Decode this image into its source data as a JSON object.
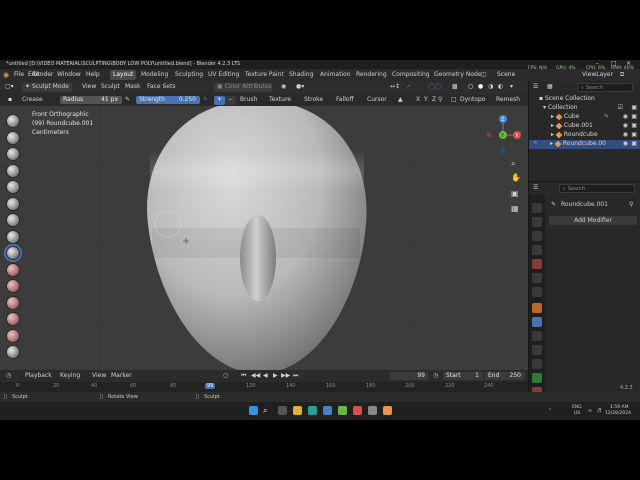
{
  "window": {
    "title": "*untitled [D:\\VIDEO MATERIAL\\SCULPTING\\BODY LOW POLY\\untitled.blend] - Blender 4.2.3 LTS"
  },
  "menubar": {
    "items": [
      "File",
      "Edit",
      "Render",
      "Window",
      "Help"
    ],
    "workspaces": [
      "Layout",
      "Modeling",
      "Sculpting",
      "UV Editing",
      "Texture Paint",
      "Shading",
      "Animation",
      "Rendering",
      "Compositing",
      "Geometry Node"
    ],
    "active_workspace": "Layout",
    "scene_label": "Scene",
    "view_layer_label": "ViewLayer"
  },
  "viewport_header": {
    "mode": "Sculpt Mode",
    "menus": [
      "View",
      "Sculpt",
      "Mask",
      "Face Sets"
    ],
    "color_attributes": "Color Attributes"
  },
  "tool_header": {
    "tool": "Crease",
    "radius_label": "Radius",
    "radius_value": "41 px",
    "strength_label": "Strength",
    "strength_value": "0.250",
    "menus": [
      "Brush",
      "Texture",
      "Stroke",
      "Falloff",
      "Cursor"
    ],
    "axes": [
      "X",
      "Y",
      "Z"
    ],
    "dyntopo": "Dyntopo",
    "remesh": "Remesh"
  },
  "viewport_overlay": {
    "line1": "Front Orthographic",
    "line2": "(99) Roundcube.001",
    "line3": "Centimeters"
  },
  "nav_gizmo": {
    "axis_z": "Z",
    "axis_x": "X",
    "axis_y": "Y"
  },
  "timeline": {
    "menus": [
      "Playback",
      "Keying",
      "View",
      "Marker"
    ],
    "current_frame": "99",
    "start_label": "Start",
    "start_value": "1",
    "end_label": "End",
    "end_value": "250",
    "ticks": [
      "0",
      "20",
      "40",
      "60",
      "80",
      "99",
      "120",
      "140",
      "160",
      "180",
      "200",
      "220",
      "240"
    ]
  },
  "outliner": {
    "search_placeholder": "Search",
    "root": "Scene Collection",
    "collection": "Collection",
    "objects": [
      "Cube",
      "Cube.001",
      "Roundcube",
      "Roundcube.00"
    ],
    "selected_index": 3
  },
  "properties": {
    "search_placeholder": "Search",
    "object_name": "Roundcube.001",
    "add_modifier": "Add Modifier"
  },
  "statusbar": {
    "left": "Sculpt",
    "middle": "Rotate View",
    "right_action": "Sculpt",
    "version": "4.2.3",
    "fps": "FPS: N/A",
    "gpu": "GPU: 4%",
    "cpu": "CPU: 6%",
    "ram": "RAM: 40%"
  },
  "taskbar": {
    "search_placeholder": "Search",
    "lang": "ENG",
    "lang2": "US",
    "time": "1:59 AM",
    "date": "12/28/2024"
  }
}
